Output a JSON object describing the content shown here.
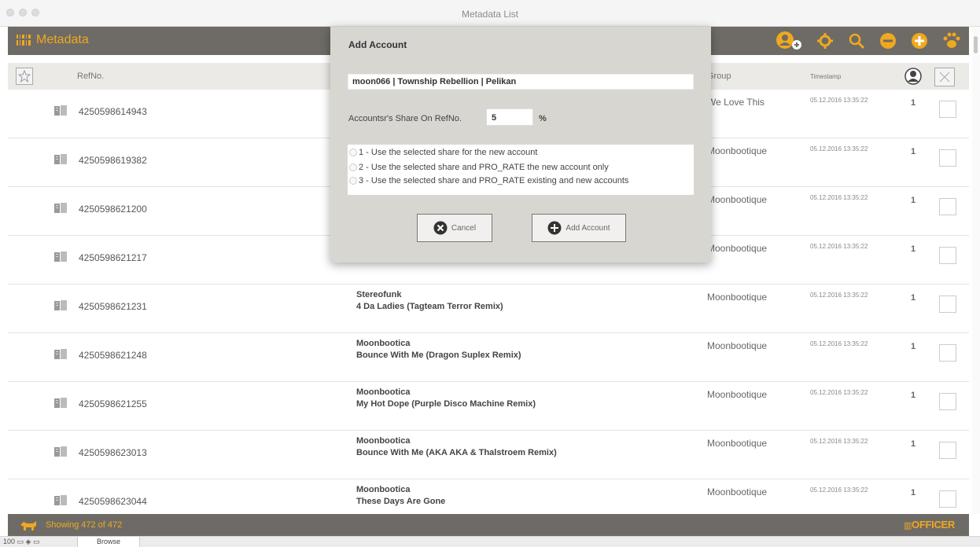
{
  "window": {
    "title": "Metadata List"
  },
  "toolbar": {
    "title": "Metadata",
    "icons": [
      "add-account-icon",
      "settings-icon",
      "search-icon",
      "remove-icon",
      "add-icon",
      "paw-icon"
    ]
  },
  "table": {
    "headers": {
      "refno": "RefNo.",
      "group": "Group",
      "timestamp": "Timestamp"
    },
    "rows": [
      {
        "refno": "4250598614943",
        "artist": "",
        "track": "",
        "group": "We Love This",
        "timestamp": "05.12.2016 13:35:22",
        "count": "1"
      },
      {
        "refno": "4250598619382",
        "artist": "",
        "track": "",
        "group": "Moonbootique",
        "timestamp": "05.12.2016 13:35:22",
        "count": "1"
      },
      {
        "refno": "4250598621200",
        "artist": "",
        "track": "",
        "group": "Moonbootique",
        "timestamp": "05.12.2016 13:35:22",
        "count": "1"
      },
      {
        "refno": "4250598621217",
        "artist": "",
        "track": "",
        "group": "Moonbootique",
        "timestamp": "05.12.2016 13:35:22",
        "count": "1"
      },
      {
        "refno": "4250598621231",
        "artist": "Stereofunk",
        "track": "4 Da Ladies (Tagteam Terror Remix)",
        "group": "Moonbootique",
        "timestamp": "05.12.2016 13:35:22",
        "count": "1"
      },
      {
        "refno": "4250598621248",
        "artist": "Moonbootica",
        "track": "Bounce With Me (Dragon Suplex Remix)",
        "group": "Moonbootique",
        "timestamp": "05.12.2016 13:35:22",
        "count": "1"
      },
      {
        "refno": "4250598621255",
        "artist": "Moonbootica",
        "track": "My Hot Dope (Purple Disco Machine Remix)",
        "group": "Moonbootique",
        "timestamp": "05.12.2016 13:35:22",
        "count": "1"
      },
      {
        "refno": "4250598623013",
        "artist": "Moonbootica",
        "track": "Bounce With Me (AKA AKA & Thalstroem Remix)",
        "group": "Moonbootique",
        "timestamp": "05.12.2016 13:35:22",
        "count": "1"
      },
      {
        "refno": "4250598623044",
        "artist": "Moonbootica",
        "track": "These Days Are Gone",
        "group": "Moonbootique",
        "timestamp": "05.12.2016 13:35:22",
        "count": "1"
      }
    ]
  },
  "status": {
    "text": "Showing 472 of 472",
    "logo": "OFFICER"
  },
  "bottom": {
    "zoom": "100",
    "mode": "Browse"
  },
  "modal": {
    "title": "Add Account",
    "account_value": "moon066 | Township Rebellion | Pelikan",
    "share_label": "Accountsr's Share On RefNo.",
    "share_value": "5",
    "percent": "%",
    "options": [
      "1 - Use the selected share for the new account",
      "2 - Use the selected share and PRO_RATE the new account only",
      "3 - Use the selected share and PRO_RATE existing and new accounts"
    ],
    "cancel_label": "Cancel",
    "add_label": "Add Account"
  },
  "colors": {
    "accent": "#f0a81e",
    "toolbar": "#6e6b66",
    "modal": "#d8d6d1"
  }
}
